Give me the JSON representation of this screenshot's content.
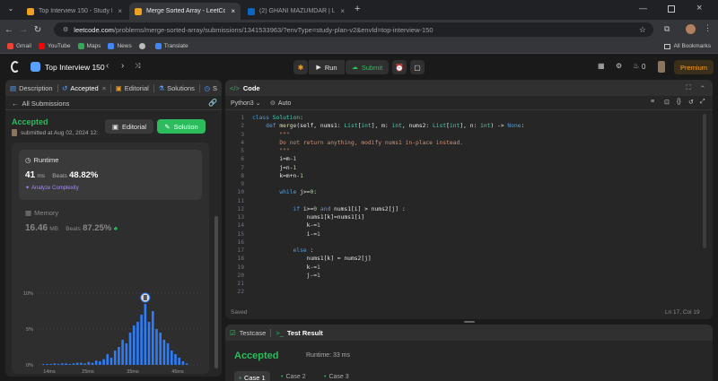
{
  "browser": {
    "tabs": [
      {
        "title": "Top Interview 150 - Study Plan - ",
        "favicon": "#f0a020"
      },
      {
        "title": "Merge Sorted Array - LeetCode",
        "favicon": "#f0a020"
      },
      {
        "title": "(2) GHANI MAZUMDAR | Linkedi",
        "favicon": "#0a66c2"
      }
    ],
    "url_domain": "leetcode.com",
    "url_path": "/problems/merge-sorted-array/submissions/1341533963/?envType=study-plan-v2&envId=top-interview-150",
    "bookmarks": [
      {
        "label": "Gmail",
        "color": "#ea4335"
      },
      {
        "label": "YouTube",
        "color": "#ff0000"
      },
      {
        "label": "Maps",
        "color": "#34a853"
      },
      {
        "label": "News",
        "color": "#4285f4"
      },
      {
        "label": "",
        "color": "#bbbbbb"
      },
      {
        "label": "Translate",
        "color": "#4285f4"
      }
    ],
    "all_bookmarks": "All Bookmarks"
  },
  "nav": {
    "list_title": "Top Interview 150",
    "run": "Run",
    "submit": "Submit",
    "fire_count": "0",
    "premium": "Premium"
  },
  "left": {
    "tabs": [
      "Description",
      "Accepted",
      "Editorial",
      "Solutions",
      "S"
    ],
    "all_submissions": "All Submissions",
    "status": "Accepted",
    "submitted": "submitted at Aug 02, 2024 12:",
    "editorial_btn": "Editorial",
    "solution_btn": "Solution",
    "runtime_label": "Runtime",
    "runtime_value": "41",
    "runtime_unit": "ms",
    "runtime_beats_label": "Beats",
    "runtime_beats": "48.82%",
    "analyze": "Analyze Complexity",
    "memory_label": "Memory",
    "memory_value": "16.46",
    "memory_unit": "MB",
    "memory_beats_label": "Beats",
    "memory_beats": "87.25%"
  },
  "chart_data": {
    "type": "bar",
    "y_ticks": [
      "10%",
      "5%",
      "0%"
    ],
    "ylim": [
      0,
      10
    ],
    "x_ticks": [
      "14ms",
      "25ms",
      "35ms",
      "45ms"
    ],
    "values": [
      0.1,
      0.1,
      0.1,
      0.2,
      0.1,
      0.2,
      0.2,
      0.1,
      0.2,
      0.3,
      0.3,
      0.2,
      0.4,
      0.3,
      0.6,
      0.5,
      0.8,
      1.5,
      1.0,
      2.0,
      2.5,
      3.5,
      3.0,
      4.5,
      5.5,
      6.0,
      7.0,
      8.5,
      6.0,
      7.5,
      5.0,
      4.5,
      3.5,
      3.0,
      2.0,
      1.5,
      1.0,
      0.5,
      0.2
    ],
    "highlight_index": 27,
    "color": "#2f7df6"
  },
  "code": {
    "title": "Code",
    "language": "Python3",
    "auto": "Auto",
    "status": "Saved",
    "cursor": "Ln 17, Col 19",
    "line_numbers": [
      "1",
      "2",
      "3",
      "4",
      "5",
      "6",
      "7",
      "8",
      "9",
      "10",
      "11",
      "12",
      "13",
      "14",
      "15",
      "16",
      "17",
      "18",
      "19",
      "20",
      "21",
      "22"
    ]
  },
  "bottom": {
    "testcase_tab": "Testcase",
    "result_tab": "Test Result",
    "status": "Accepted",
    "runtime": "Runtime: 33 ms",
    "cases": [
      "Case 1",
      "Case 2",
      "Case 3"
    ]
  }
}
